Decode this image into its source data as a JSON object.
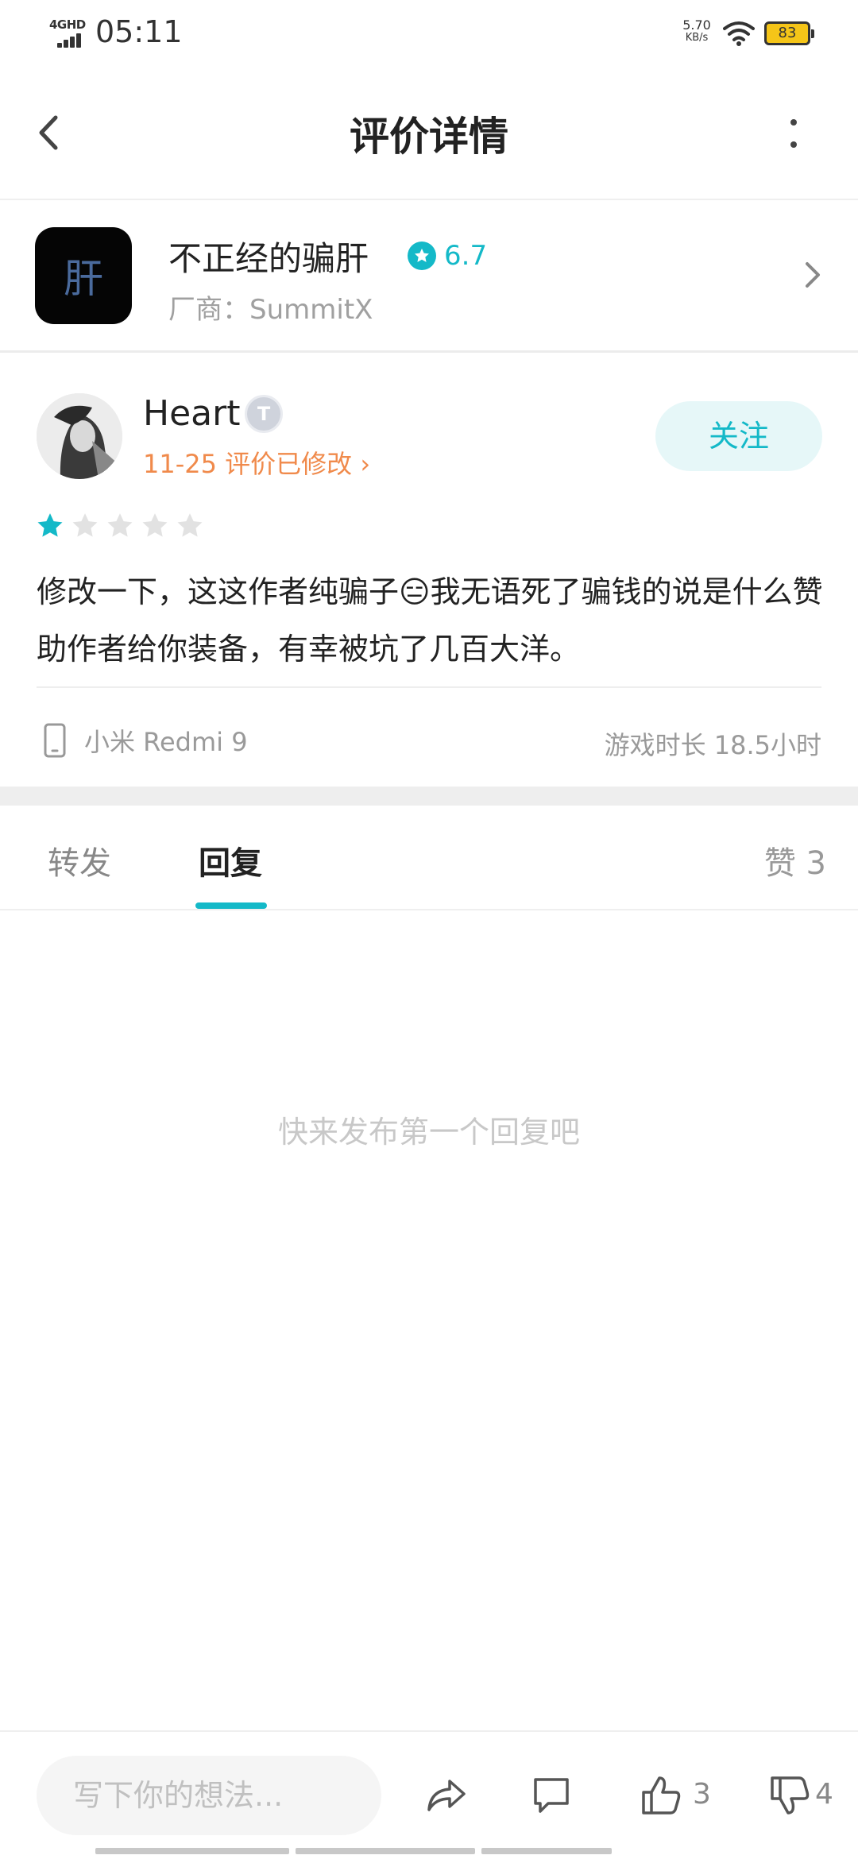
{
  "status_bar": {
    "network": "4GHD",
    "time": "05:11",
    "speed_value": "5.70",
    "speed_unit": "KB/s",
    "battery": "83"
  },
  "header": {
    "title": "评价详情",
    "back_icon": "chevron-left-icon",
    "more_icon": "more-vertical-icon"
  },
  "app": {
    "icon_text": "肝",
    "name": "不正经的骗肝",
    "rating": "6.7",
    "vendor": "厂商：SummitX"
  },
  "review": {
    "username": "Heart",
    "badge": "T",
    "meta": "11-25 评价已修改",
    "follow_label": "关注",
    "stars_filled": 1,
    "stars_total": 5,
    "text": "修改一下，这这作者纯骗子😑我无语死了骗钱的说是什么赞助作者给你装备，有幸被坑了几百大洋。",
    "device": "小米 Redmi 9",
    "playtime": "游戏时长 18.5小时"
  },
  "tabs": {
    "forward": "转发",
    "reply": "回复",
    "likes": "赞 3"
  },
  "empty_state": "快来发布第一个回复吧",
  "bottom_bar": {
    "placeholder": "写下你的想法...",
    "like_count": "3",
    "dislike_count": "4"
  },
  "colors": {
    "accent": "#14b9c8",
    "meta_orange": "#f08a4b"
  }
}
